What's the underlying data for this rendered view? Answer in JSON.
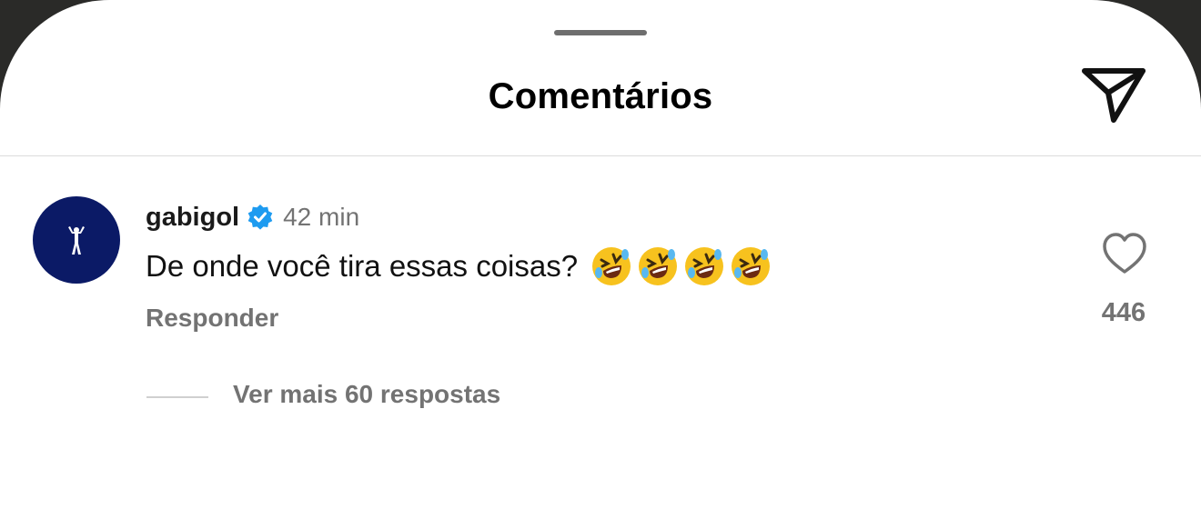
{
  "header": {
    "title": "Comentários",
    "share_icon": "paper-plane-icon"
  },
  "comment": {
    "username": "gabigol",
    "verified": true,
    "time": "42 min",
    "text": "De onde você tira essas coisas?",
    "emojis": [
      "rolling-on-floor-laughing",
      "rolling-on-floor-laughing",
      "rolling-on-floor-laughing",
      "rolling-on-floor-laughing"
    ],
    "reply_label": "Responder",
    "like_icon": "heart-outline-icon",
    "like_count": "446",
    "more_replies_label": "Ver mais 60 respostas"
  },
  "colors": {
    "avatar_bg": "#0b1a66",
    "verified_blue": "#1d9bf0",
    "secondary_text": "#737373"
  }
}
